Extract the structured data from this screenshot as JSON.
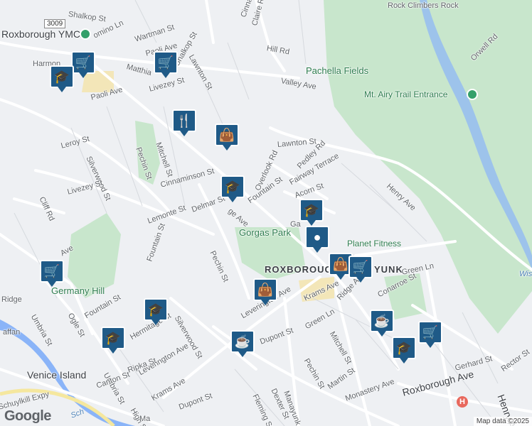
{
  "map": {
    "attribution": "Map data ©2025",
    "logo": "Google",
    "colors": {
      "park": "#c8e6cc",
      "water": "#8ab4f8",
      "road": "#ffffff",
      "background": "#eef0f3",
      "marker": "#1f5a87"
    }
  },
  "labels": {
    "shalkop_top": "Shalkop St",
    "route_3009": "3009",
    "roxborough_ymca": "Roxborough YMCA",
    "harmony": "Harmon",
    "domino": "omino Ln",
    "wartman": "Wartman St",
    "paoli_top": "Paoli Ave",
    "lawnton_top": "Lawnton St",
    "matthias": "Matthia",
    "shalkop_mid": "Shalkop St",
    "claire": "Claire Rd",
    "cinnaminson_top": "Cinna",
    "hill": "Hill Rd",
    "valley": "Valley Ave",
    "pachella": "Pachella Fields",
    "mt_airy": "Mt. Airy Trail Entrance",
    "orwell": "Orwell Rd",
    "livezey_top": "Livezey St",
    "paoli_ave": "Paoli Ave",
    "mitchell_left": "Mitchell St",
    "pechin_left": "Pechin St",
    "leroy": "Leroy St",
    "silverwood_left": "Silverwood St",
    "livezey_left": "Livezey St",
    "cliff": "Cliff Rd",
    "cinnaminson": "Cinnaminson St",
    "lawnton_mid": "Lawnton St",
    "overlook": "Overlook Rd",
    "pedley": "Pedley Rd",
    "fairway": "Fairway Terrace",
    "fountain_mid": "Fountain St",
    "acorn": "Acorn St",
    "henry_top": "Henry Ave",
    "lemonte": "Lemonte St",
    "delmar": "Delmar St",
    "ridge_mid": "ge Ave",
    "gorgas_park": "Gorgas Park",
    "gat": "Ga",
    "planet_fitness": "Planet Fitness",
    "ave_left": "Ave",
    "fountain_left": "Fountain St",
    "pechin_mid": "Pechin St",
    "roxborough": "ROXBOROUGH",
    "manayunk_top": "YUNK",
    "green_ln_right": "Green Ln",
    "germany_hill": "Germany Hill",
    "ridge_left": "Ridge",
    "umbria_left": "Umbria St",
    "ogle": "Ogle St",
    "fountain_low": "Fountain St",
    "hermitage": "Hermitage St",
    "silverwood_low": "Silverwood St",
    "leverington_mid": "Leverington Ave",
    "krams_mid": "Krams Ave",
    "ridge_low": "Ridge Ave",
    "conarroe": "Conarroe St",
    "green_ln": "Green Ln",
    "mitchell_low": "Mitchell St",
    "dupont_mid": "Dupont St",
    "pechin_low": "Pechin St",
    "leverington_low": "Leverington Ave",
    "venice_island": "Venice Island",
    "umbria_low": "Umbria St",
    "ripka": "Ripka St",
    "canton": "Canton St",
    "krams_low": "Krams Ave",
    "dupont_low": "Dupont St",
    "high": "High St",
    "fleming": "Fleming St",
    "dexter": "Dexter St",
    "manayunk_ave": "Manayunk Ave",
    "martin": "Martin St",
    "monastery": "Monastery Ave",
    "roxborough_ave": "Roxborough Ave",
    "gerhard": "Gerhard St",
    "rector": "Rector St",
    "henry_low": "Henry Ave",
    "schuylkill_expy": "Schuylkill Expy",
    "wiss": "Wiss",
    "schuylkill_river": "Sch",
    "rock_climbers": "Rock Climbers Rock",
    "shaffan": "affan",
    "ma_bottom": "Ma"
  },
  "markers": [
    {
      "kind": "shopping-cart",
      "glyph": "🛒"
    },
    {
      "kind": "school",
      "glyph": "🎓"
    },
    {
      "kind": "shopping-cart",
      "glyph": "🛒"
    },
    {
      "kind": "restaurant",
      "glyph": "🍴"
    },
    {
      "kind": "shopping-bag",
      "glyph": "👜"
    },
    {
      "kind": "school",
      "glyph": "🎓"
    },
    {
      "kind": "school",
      "glyph": "🎓"
    },
    {
      "kind": "fitness",
      "glyph": "●"
    },
    {
      "kind": "shopping-bag",
      "glyph": "👜"
    },
    {
      "kind": "shopping-cart",
      "glyph": "🛒"
    },
    {
      "kind": "shopping-cart",
      "glyph": "🛒"
    },
    {
      "kind": "shopping-bag",
      "glyph": "👜"
    },
    {
      "kind": "school",
      "glyph": "🎓"
    },
    {
      "kind": "school",
      "glyph": "🎓"
    },
    {
      "kind": "cafe",
      "glyph": "☕"
    },
    {
      "kind": "cafe",
      "glyph": "☕"
    },
    {
      "kind": "shopping-cart",
      "glyph": "🛒"
    },
    {
      "kind": "school",
      "glyph": "🎓"
    }
  ]
}
